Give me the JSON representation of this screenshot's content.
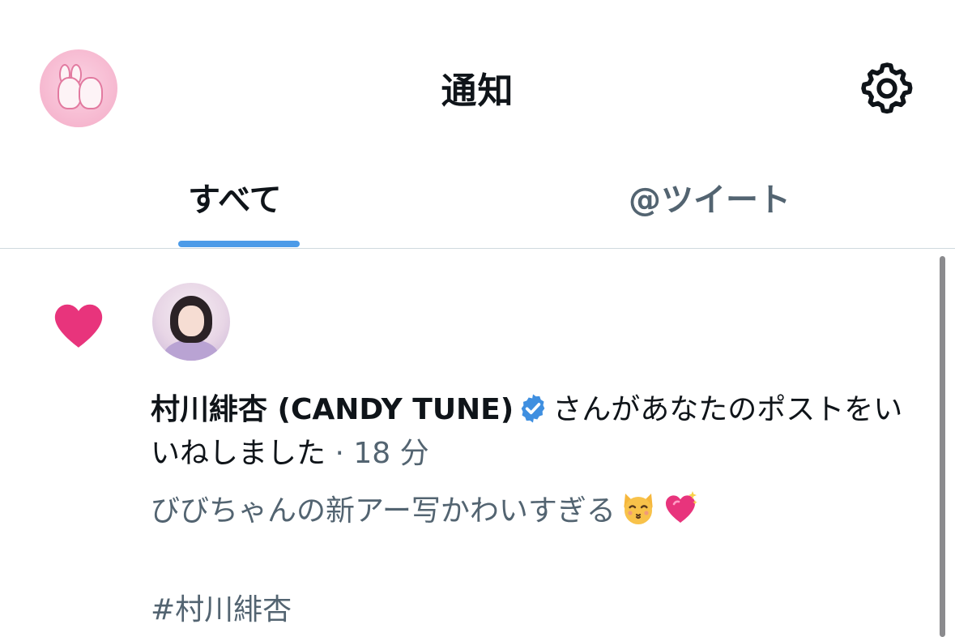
{
  "header": {
    "title": "通知",
    "avatar_icon": "profile-avatar",
    "settings_icon": "gear-icon"
  },
  "tabs": [
    {
      "label": "すべて",
      "selected": true
    },
    {
      "label": "@ツイート",
      "selected": false
    }
  ],
  "colors": {
    "accent": "#4c9be8",
    "heart": "#e8347c",
    "verified": "#3f8fe0",
    "secondary_text": "#536471"
  },
  "notification": {
    "type_icon": "heart-icon",
    "user_avatar_icon": "user-avatar",
    "user_name": "村川緋杏 (CANDY TUNE)",
    "verified_icon": "verified-badge-icon",
    "action_text": "さんがあなたのポストをいいねしました",
    "separator": "·",
    "time": "18 分",
    "tweet_text": "びびちゃんの新アー写かわいすぎる",
    "tweet_emojis": [
      "kissing-cat-face-emoji",
      "sparkling-heart-emoji"
    ],
    "hashtag": "#村川緋杏"
  }
}
